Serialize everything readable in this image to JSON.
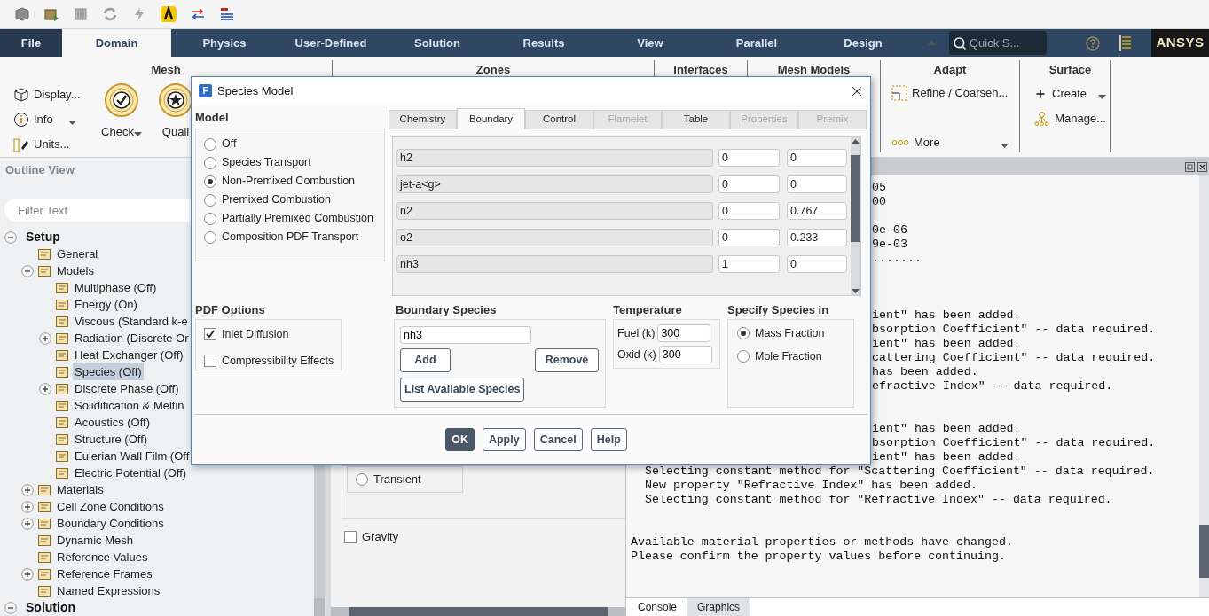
{
  "ribbon_tabs": [
    {
      "label": "File",
      "selected": false
    },
    {
      "label": "Domain",
      "selected": true
    },
    {
      "label": "Physics",
      "selected": false
    },
    {
      "label": "User-Defined",
      "selected": false
    },
    {
      "label": "Solution",
      "selected": false
    },
    {
      "label": "Results",
      "selected": false
    },
    {
      "label": "View",
      "selected": false
    },
    {
      "label": "Parallel",
      "selected": false
    },
    {
      "label": "Design",
      "selected": false
    }
  ],
  "quick_search": {
    "placeholder": "Quick S..."
  },
  "logo": "ANSYS",
  "ribbon": {
    "mesh": {
      "title": "Mesh",
      "items": [
        {
          "label": "Display...",
          "dropdown": false
        },
        {
          "label": "Info",
          "dropdown": true
        },
        {
          "label": "Units...",
          "dropdown": false
        }
      ],
      "big_buttons": [
        {
          "label": "Check",
          "dropdown": true
        },
        {
          "label": "Quali",
          "dropdown": false
        }
      ]
    },
    "zones": {
      "title": "Zones"
    },
    "interfaces": {
      "title": "Interfaces"
    },
    "mesh_models": {
      "title": "Mesh Models"
    },
    "adapt": {
      "title": "Adapt",
      "items": [
        {
          "label": "Refine / Coarsen...",
          "dropdown": false
        },
        {
          "label": "More",
          "dropdown": true
        }
      ]
    },
    "surface": {
      "title": "Surface",
      "items": [
        {
          "label": "Create",
          "dropdown": true
        },
        {
          "label": "Manage...",
          "dropdown": false
        }
      ]
    }
  },
  "outline": {
    "title": "Outline View",
    "filter": {
      "placeholder": "Filter Text"
    },
    "tree": [
      {
        "label": "Setup",
        "expanded": true,
        "selected": false,
        "children": [
          {
            "label": "General",
            "selected": false
          },
          {
            "label": "Models",
            "expanded": true,
            "selected": false,
            "children": [
              {
                "label": "Multiphase (Off)",
                "selected": false
              },
              {
                "label": "Energy (On)",
                "selected": false
              },
              {
                "label": "Viscous (Standard k-e",
                "selected": false
              },
              {
                "label": "Radiation (Discrete Or",
                "expanded": false,
                "selected": false
              },
              {
                "label": "Heat Exchanger (Off)",
                "selected": false
              },
              {
                "label": "Species (Off)",
                "selected": true
              },
              {
                "label": "Discrete Phase (Off)",
                "expanded": false,
                "selected": false
              },
              {
                "label": "Solidification & Meltin",
                "selected": false
              },
              {
                "label": "Acoustics (Off)",
                "selected": false
              },
              {
                "label": "Structure (Off)",
                "selected": false
              },
              {
                "label": "Eulerian Wall Film (Off",
                "selected": false
              },
              {
                "label": "Electric Potential (Off)",
                "selected": false
              }
            ]
          },
          {
            "label": "Materials",
            "expanded": false,
            "selected": false
          },
          {
            "label": "Cell Zone Conditions",
            "expanded": false,
            "selected": false
          },
          {
            "label": "Boundary Conditions",
            "expanded": false,
            "selected": false
          },
          {
            "label": "Dynamic Mesh",
            "selected": false
          },
          {
            "label": "Reference Values",
            "selected": false
          },
          {
            "label": "Reference Frames",
            "expanded": false,
            "selected": false
          },
          {
            "label": "Named Expressions",
            "selected": false
          }
        ]
      },
      {
        "label": "Solution",
        "expanded": true,
        "selected": false
      }
    ]
  },
  "task_panel": {
    "time_options": [
      {
        "label": "Transient",
        "selected": false
      }
    ],
    "gravity": {
      "label": "Gravity",
      "checked": false
    }
  },
  "console": {
    "lines": [
      {
        "text": "05",
        "covered": true,
        "blank": false
      },
      {
        "text": "00",
        "covered": true,
        "blank": false
      },
      {
        "blank": true
      },
      {
        "text": "0e-06",
        "covered": true,
        "blank": false
      },
      {
        "text": "9e-03",
        "covered": true,
        "blank": false
      },
      {
        "text": ".......",
        "covered": true,
        "blank": false
      },
      {
        "blank": true
      },
      {
        "blank": true
      },
      {
        "blank": true
      },
      {
        "text": "ient\" has been added.",
        "covered": true,
        "blank": false
      },
      {
        "text": "bsorption Coefficient\" -- data required.",
        "covered": true,
        "blank": false
      },
      {
        "text": "ient\" has been added.",
        "covered": true,
        "blank": false
      },
      {
        "text": "cattering Coefficient\" -- data required.",
        "covered": true,
        "blank": false
      },
      {
        "text": "has been added.",
        "covered": true,
        "blank": false
      },
      {
        "text": "efractive Index\" -- data required.",
        "covered": true,
        "blank": false
      },
      {
        "blank": true
      },
      {
        "blank": true
      },
      {
        "text": "ient\" has been added.",
        "covered": true,
        "blank": false
      },
      {
        "text": "bsorption Coefficient\" -- data required.",
        "covered": true,
        "blank": false
      },
      {
        "text": "ient\" has been added.",
        "covered": true,
        "blank": false
      },
      {
        "text": "  Selecting constant method for \"Scattering Coefficient\" -- data required.",
        "blank": false
      },
      {
        "text": "  New property \"Refractive Index\" has been added.",
        "blank": false
      },
      {
        "text": "  Selecting constant method for \"Refractive Index\" -- data required.",
        "blank": false
      },
      {
        "blank": true
      },
      {
        "blank": true
      },
      {
        "text": "Available material properties or methods have changed.",
        "blank": false
      },
      {
        "text": "Please confirm the property values before continuing.",
        "blank": false
      }
    ],
    "tabs": [
      {
        "label": "Console",
        "selected": true
      },
      {
        "label": "Graphics",
        "selected": false
      }
    ]
  },
  "dialog": {
    "title": "Species Model",
    "app_icon_letter": "F",
    "model": {
      "title": "Model",
      "options": [
        {
          "label": "Off",
          "selected": false
        },
        {
          "label": "Species Transport",
          "selected": false
        },
        {
          "label": "Non-Premixed Combustion",
          "selected": true
        },
        {
          "label": "Premixed Combustion",
          "selected": false
        },
        {
          "label": "Partially Premixed Combustion",
          "selected": false
        },
        {
          "label": "Composition PDF Transport",
          "selected": false
        }
      ]
    },
    "pdf_options": {
      "title": "PDF Options",
      "options": [
        {
          "label": "Inlet Diffusion",
          "checked": true
        },
        {
          "label": "Compressibility Effects",
          "checked": false
        }
      ]
    },
    "tabs": [
      {
        "label": "Chemistry",
        "selected": false,
        "disabled": false
      },
      {
        "label": "Boundary",
        "selected": true,
        "disabled": false
      },
      {
        "label": "Control",
        "selected": false,
        "disabled": false
      },
      {
        "label": "Flamelet",
        "selected": false,
        "disabled": true
      },
      {
        "label": "Table",
        "selected": false,
        "disabled": false
      },
      {
        "label": "Properties",
        "selected": false,
        "disabled": true
      },
      {
        "label": "Premix",
        "selected": false,
        "disabled": true
      }
    ],
    "species_rows": [
      {
        "name": "h2",
        "column_2": "0",
        "column_3": "0"
      },
      {
        "name": "jet-a<g>",
        "column_2": "0",
        "column_3": "0"
      },
      {
        "name": "n2",
        "column_2": "0",
        "column_3": "0.767"
      },
      {
        "name": "o2",
        "column_2": "0",
        "column_3": "0.233"
      },
      {
        "name": "nh3",
        "column_2": "1",
        "column_3": "0"
      }
    ],
    "boundary_species": {
      "title": "Boundary Species",
      "value": "nh3",
      "buttons": [
        "Add",
        "Remove",
        "List Available Species"
      ]
    },
    "temperature": {
      "title": "Temperature",
      "fields": [
        {
          "label": "Fuel (k)",
          "value": "300"
        },
        {
          "label": "Oxid (k)",
          "value": "300"
        }
      ]
    },
    "specify_species": {
      "title": "Specify Species in",
      "options": [
        {
          "label": "Mass Fraction",
          "selected": true
        },
        {
          "label": "Mole Fraction",
          "selected": false
        }
      ]
    },
    "buttons": [
      {
        "label": "OK",
        "default": true
      },
      {
        "label": "Apply",
        "default": false
      },
      {
        "label": "Cancel",
        "default": false
      },
      {
        "label": "Help",
        "default": false
      }
    ]
  }
}
